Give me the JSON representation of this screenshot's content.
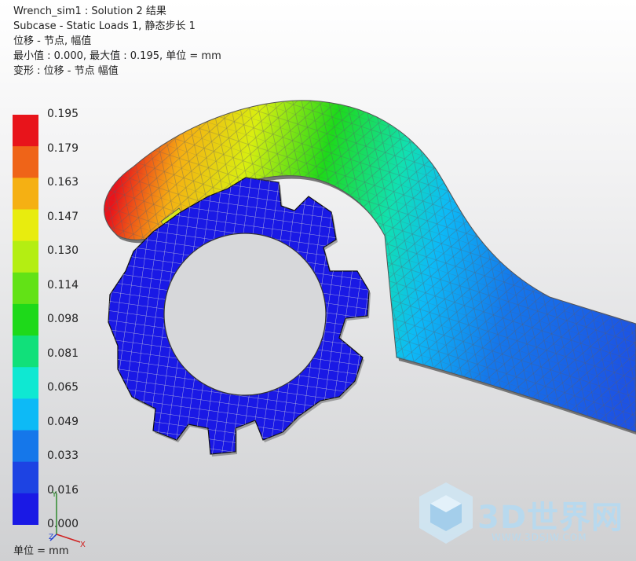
{
  "header": {
    "line1": "Wrench_sim1 : Solution 2 结果",
    "line2": "Subcase - Static Loads 1, 静态步长 1",
    "line3": "位移 - 节点, 幅值",
    "line4": "最小值 : 0.000, 最大值 : 0.195, 单位 = mm",
    "line5": "变形 : 位移 - 节点 幅值"
  },
  "legend": {
    "ticks": [
      "0.195",
      "0.179",
      "0.163",
      "0.147",
      "0.130",
      "0.114",
      "0.098",
      "0.081",
      "0.065",
      "0.049",
      "0.033",
      "0.016",
      "0.000"
    ],
    "colors": [
      "#e8141b",
      "#ef6418",
      "#f5b013",
      "#e8ec0e",
      "#b4ee12",
      "#62e216",
      "#1ed91a",
      "#11e07a",
      "#0fe8d2",
      "#0dbaf6",
      "#1577ea",
      "#1d43e3",
      "#1a19e5"
    ],
    "units": "单位 = mm"
  },
  "triad": {
    "x": "X",
    "y": "Y",
    "z": "Z"
  },
  "watermark": {
    "title": "3D世界网",
    "url": "WWW.3DSJW.COM"
  }
}
